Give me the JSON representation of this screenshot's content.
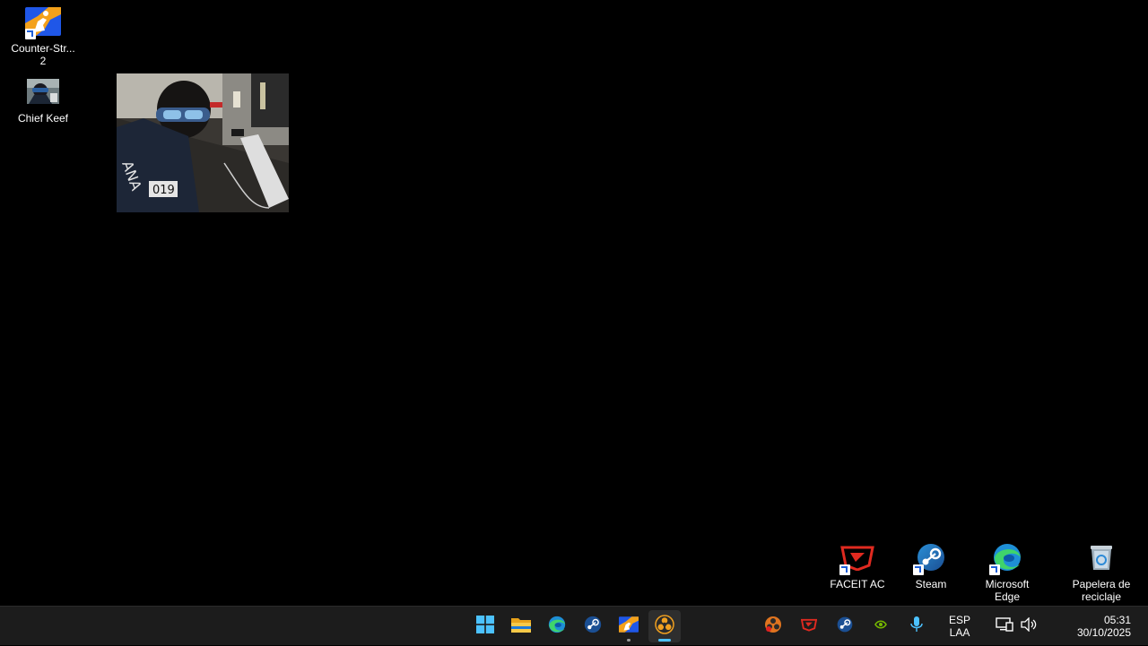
{
  "desktop": {
    "icons_left": [
      {
        "label": "Counter-Str...\n2",
        "icon": "counter-strike-2-icon"
      },
      {
        "label": "Chief Keef",
        "icon": "photo-icon"
      }
    ],
    "icons_bottom": [
      {
        "label": "FACEIT AC",
        "icon": "faceit-icon"
      },
      {
        "label": "Steam",
        "icon": "steam-icon"
      },
      {
        "label": "Microsoft\nEdge",
        "icon": "edge-icon"
      },
      {
        "label": "Papelera de\nreciclaje",
        "icon": "recycle-bin-icon"
      }
    ]
  },
  "taskbar": {
    "pinned": [
      {
        "icon": "windows-start-icon"
      },
      {
        "icon": "file-explorer-icon"
      },
      {
        "icon": "edge-icon"
      },
      {
        "icon": "steam-icon"
      },
      {
        "icon": "counter-strike-2-icon",
        "running": true
      },
      {
        "icon": "obs-studio-icon",
        "running": true,
        "active": true
      }
    ],
    "tray": {
      "icons": [
        "obs-tray-icon",
        "faceit-tray-icon",
        "steam-tray-icon",
        "nvidia-tray-icon",
        "microphone-icon"
      ],
      "language_line1": "ESP",
      "language_line2": "LAA",
      "time": "05:31",
      "date": "30/10/2025"
    }
  },
  "colors": {
    "desktop_bg": "#000000",
    "taskbar_bg": "#1c1c1c",
    "accent": "#4cc2ff"
  }
}
